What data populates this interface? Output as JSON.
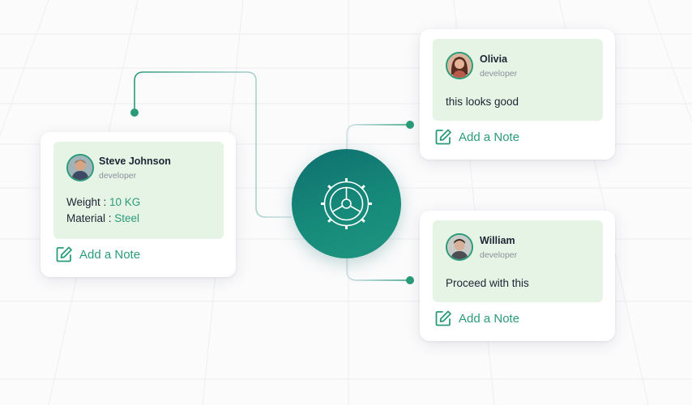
{
  "card_left": {
    "name": "Steve Johnson",
    "role": "developer",
    "weight_label": "Weight : ",
    "weight_value": "10 KG",
    "material_label": "Material : ",
    "material_value": "Steel",
    "note_label": "Add a Note"
  },
  "card_top_right": {
    "name": "Olivia",
    "role": "developer",
    "message": "this looks good",
    "note_label": "Add a Note"
  },
  "card_bottom_right": {
    "name": "William",
    "role": "developer",
    "message": "Proceed with this",
    "note_label": "Add a Note"
  },
  "colors": {
    "accent": "#2a9b78",
    "panel": "#e6f4e6",
    "hub": "#137f77"
  },
  "icons": {
    "hub": "wheel-gear-icon",
    "note": "edit-note-icon"
  }
}
